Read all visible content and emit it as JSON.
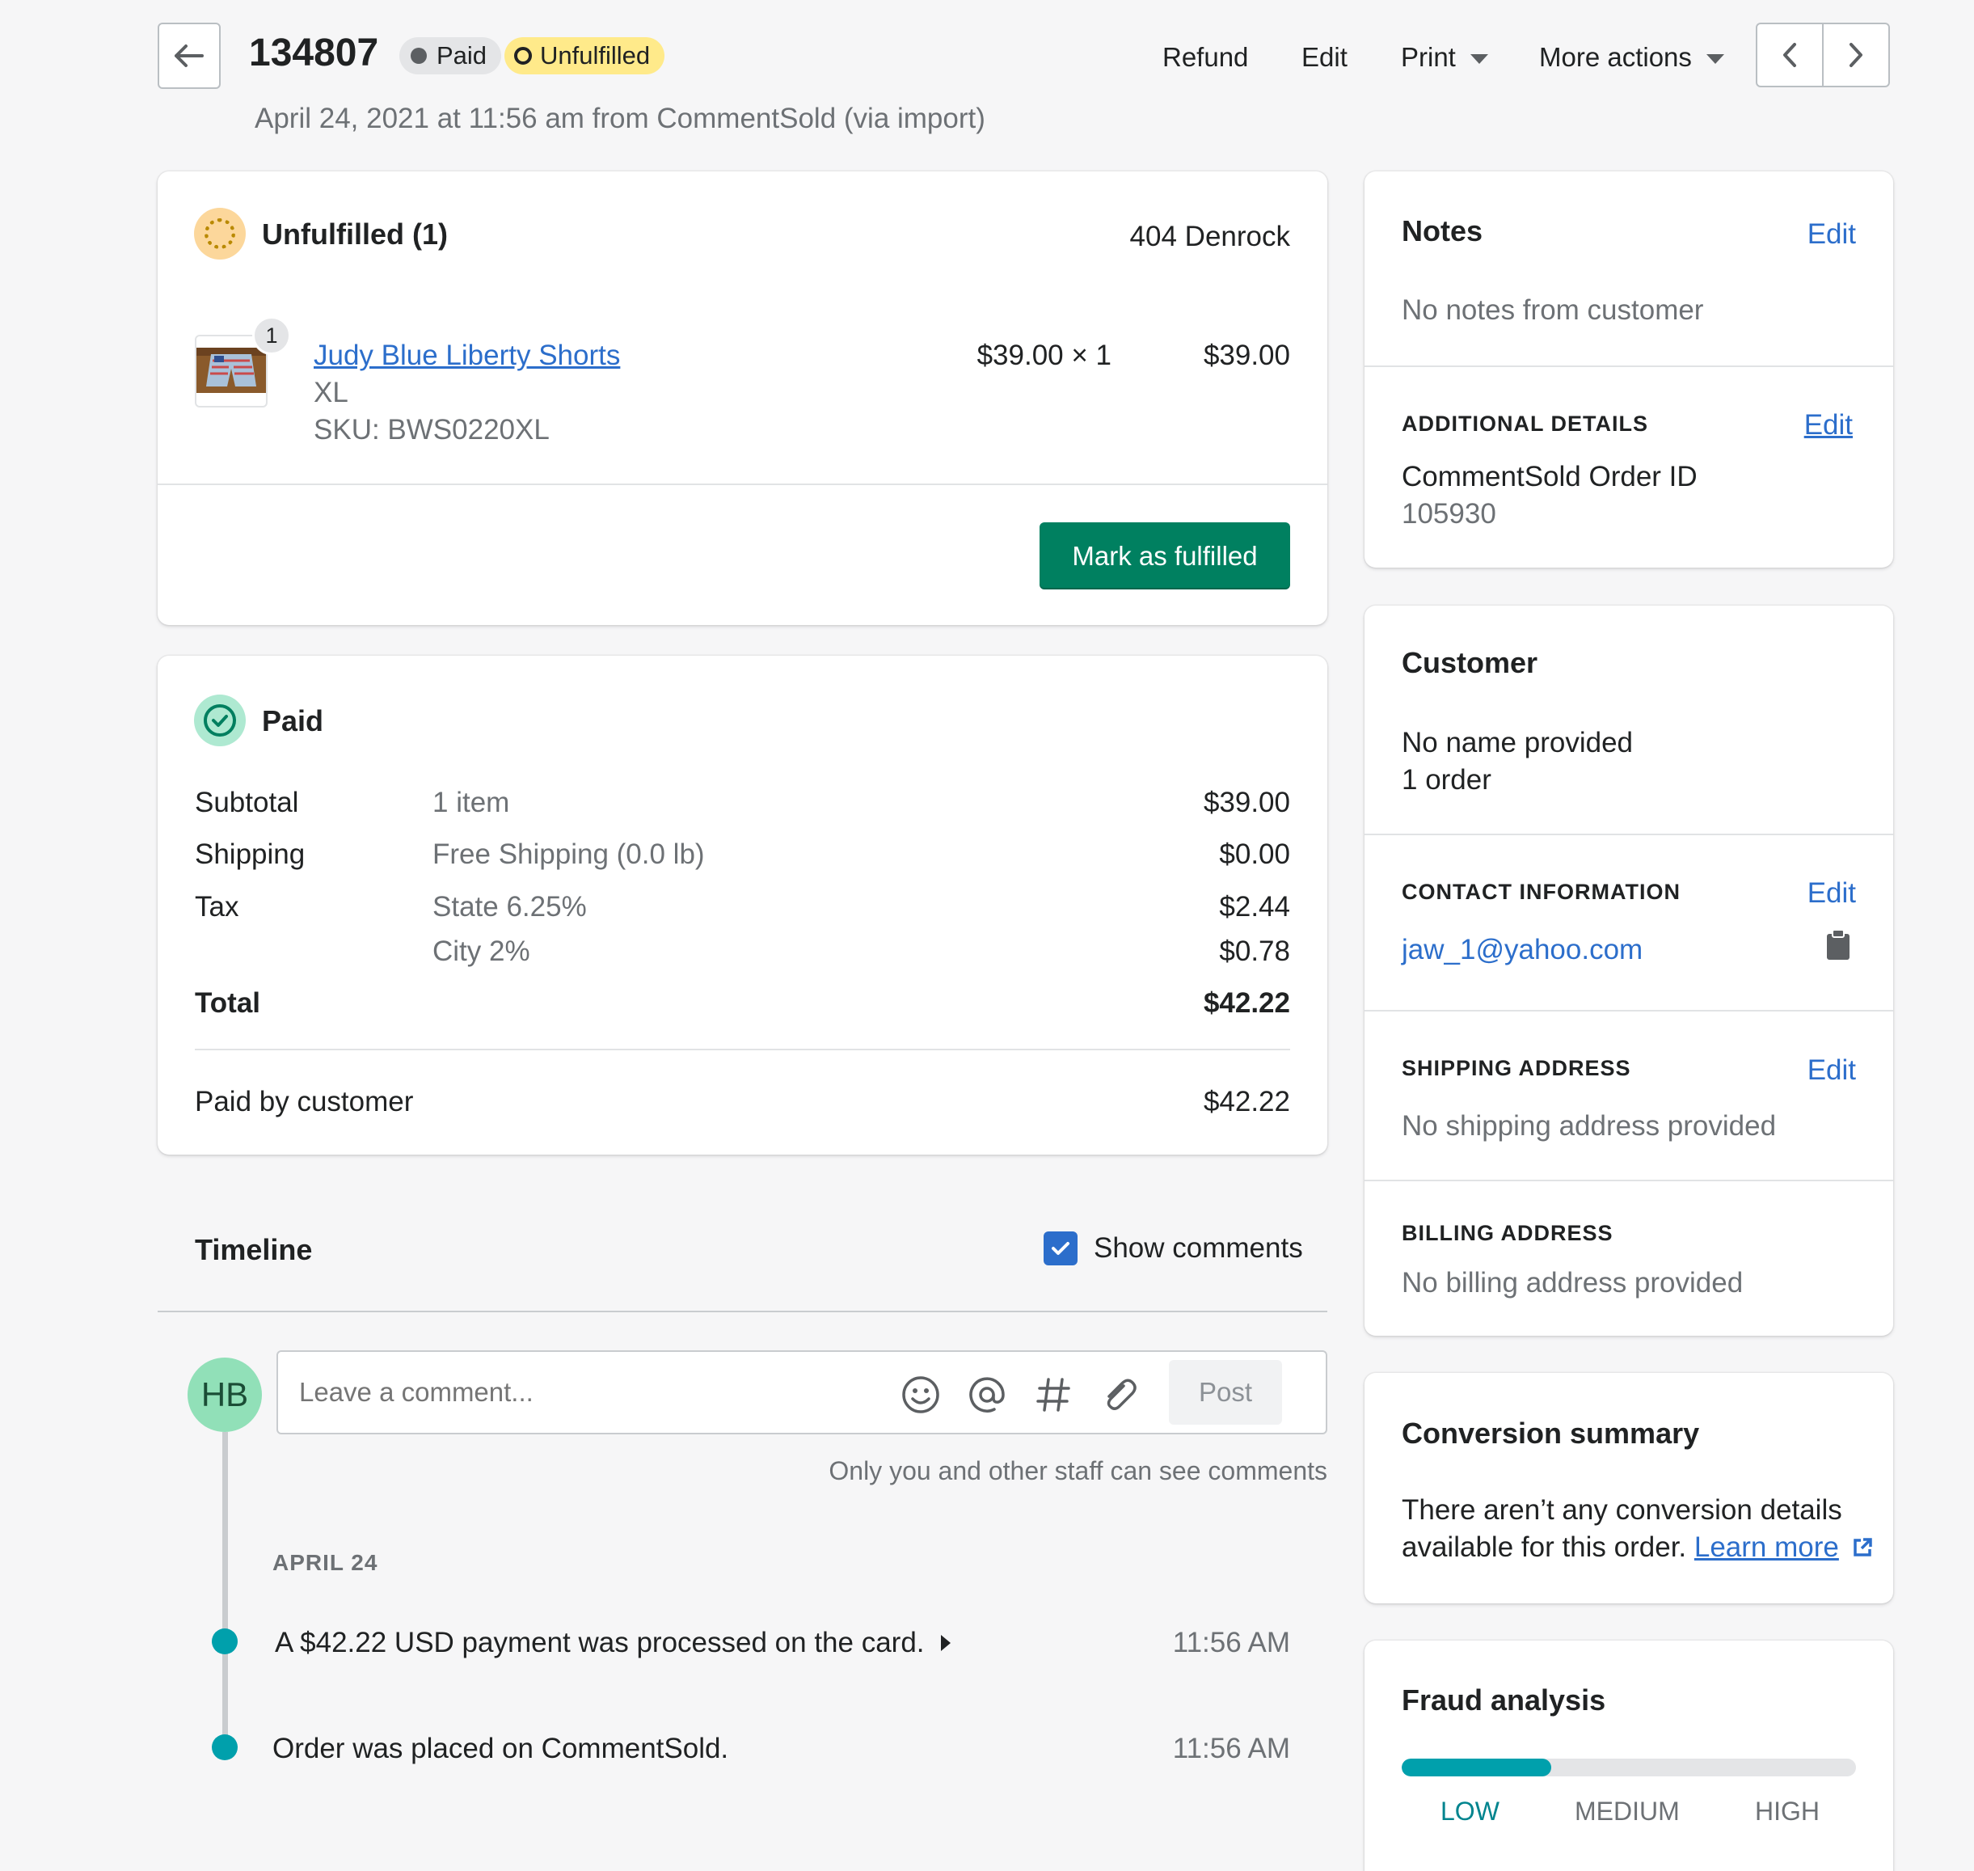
{
  "header": {
    "order_number": "134807",
    "badge_paid": "Paid",
    "badge_unfulfilled": "Unfulfilled",
    "subtitle": "April 24, 2021 at 11:56 am from CommentSold (via import)",
    "actions": {
      "refund": "Refund",
      "edit": "Edit",
      "print": "Print",
      "more_actions": "More actions"
    }
  },
  "fulfillment": {
    "title": "Unfulfilled (1)",
    "location": "404 Denrock",
    "item": {
      "quantity_badge": "1",
      "name": "Judy Blue Liberty Shorts",
      "variant": "XL",
      "sku": "SKU: BWS0220XL",
      "unit_price": "$39.00 × 1",
      "line_total": "$39.00"
    },
    "mark_fulfilled_label": "Mark as fulfilled"
  },
  "payment": {
    "title": "Paid",
    "rows": [
      {
        "label": "Subtotal",
        "desc": "1 item",
        "amount": "$39.00"
      },
      {
        "label": "Shipping",
        "desc": "Free Shipping (0.0 lb)",
        "amount": "$0.00"
      },
      {
        "label": "Tax",
        "desc": "State 6.25%",
        "amount": "$2.44"
      },
      {
        "label": "",
        "desc": "City 2%",
        "amount": "$0.78"
      }
    ],
    "total_label": "Total",
    "total_amount": "$42.22",
    "paid_label": "Paid by customer",
    "paid_amount": "$42.22"
  },
  "timeline": {
    "title": "Timeline",
    "show_comments_label": "Show comments",
    "show_comments_checked": true,
    "avatar_initials": "HB",
    "comment_placeholder": "Leave a comment...",
    "post_label": "Post",
    "staff_note": "Only you and other staff can see comments",
    "date_heading": "APRIL 24",
    "events": [
      {
        "text": "A $42.22 USD payment was processed on the card.",
        "time": "11:56 AM"
      },
      {
        "text": "Order was placed on CommentSold.",
        "time": "11:56 AM"
      }
    ]
  },
  "notes": {
    "title": "Notes",
    "edit": "Edit",
    "text": "No notes from customer",
    "additional_title": "ADDITIONAL DETAILS",
    "additional_edit": "Edit",
    "detail_label": "CommentSold Order ID",
    "detail_value": "105930"
  },
  "customer": {
    "title": "Customer",
    "name": "No name provided",
    "orders": "1 order",
    "contact_title": "CONTACT INFORMATION",
    "contact_edit": "Edit",
    "email": "jaw_1@yahoo.com",
    "shipping_title": "SHIPPING ADDRESS",
    "shipping_edit": "Edit",
    "shipping_text": "No shipping address provided",
    "billing_title": "BILLING ADDRESS",
    "billing_text": "No billing address provided"
  },
  "conversion": {
    "title": "Conversion summary",
    "line1": "There aren’t any conversion details",
    "line2": "available for this order.",
    "learn_more": "Learn more"
  },
  "fraud": {
    "title": "Fraud analysis",
    "level_fraction": 0.33,
    "low": "LOW",
    "medium": "MEDIUM",
    "high": "HIGH"
  },
  "colors": {
    "primary_green": "#008060",
    "link_blue": "#2c6ecb",
    "teal": "#00a0ac",
    "unfulfilled_yellow": "#ffea8a"
  }
}
